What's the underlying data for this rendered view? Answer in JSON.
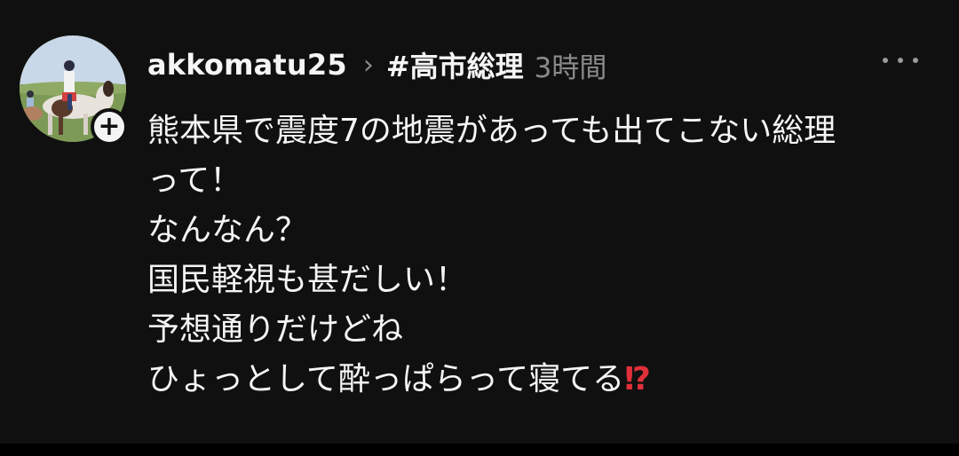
{
  "post": {
    "username": "akkomatu25",
    "topic": "#高市総理",
    "time": "3時間",
    "lines": [
      "熊本県で震度7の地震があっても出てこない総理",
      "って！",
      "なんなん？",
      "国民軽視も甚だしい！",
      "予想通りだけどね",
      "ひょっとして酔っぱらって寝てる"
    ],
    "emoji": "⁉"
  },
  "icons": {
    "more": "more-horizontal-icon",
    "follow": "plus-icon",
    "chevron": "chevron-right-icon"
  },
  "colors": {
    "background": "#101010",
    "text": "#f5f5f5",
    "muted": "#8a8a8a",
    "emoji": "#e0303a"
  }
}
